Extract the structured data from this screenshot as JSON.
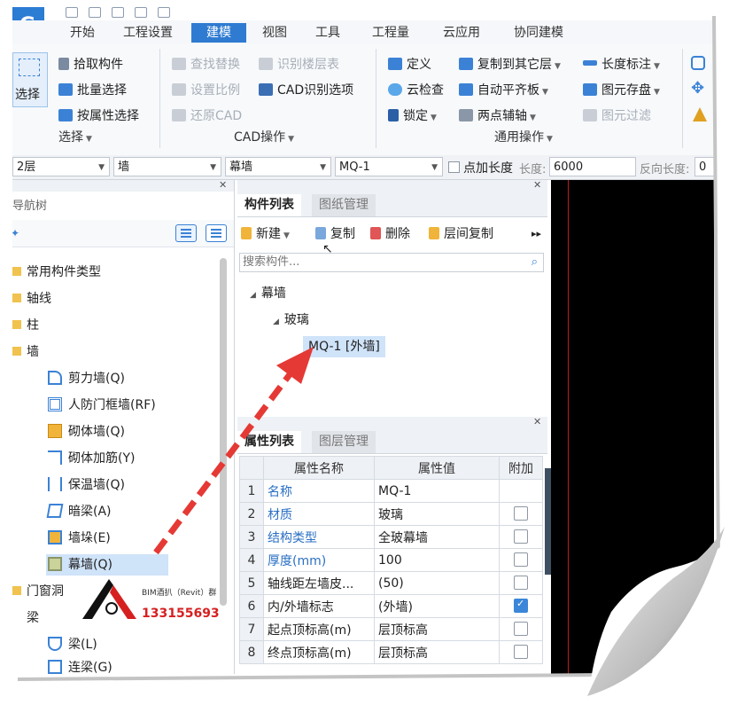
{
  "tabs": [
    "开始",
    "工程设置",
    "建模",
    "视图",
    "工具",
    "工程量",
    "云应用",
    "协同建模"
  ],
  "active_tab": "建模",
  "ribbon": {
    "select_big": "选择",
    "select_items": [
      "拾取构件",
      "批量选择",
      "按属性选择"
    ],
    "select_group": "选择",
    "cad_items": [
      "查找替换",
      "识别楼层表",
      "设置比例",
      "CAD识别选项",
      "还原CAD"
    ],
    "cad_group": "CAD操作",
    "common_col1": [
      "定义",
      "云检查",
      "锁定"
    ],
    "common_col2": [
      "复制到其它层",
      "自动平齐板",
      "两点辅轴"
    ],
    "common_col3": [
      "长度标注",
      "图元存盘",
      "图元过滤"
    ],
    "common_group": "通用操作"
  },
  "selector": {
    "floor": "2层",
    "type": "墙",
    "subtype": "幕墙",
    "component": "MQ-1",
    "point_length_label": "点加长度",
    "length_label": "长度:",
    "length_value": "6000",
    "reverse_label": "反向长度:",
    "reverse_value": "0"
  },
  "nav": {
    "title": "导航树",
    "items": {
      "common": "常用构件类型",
      "axis": "轴线",
      "column": "柱",
      "wall": "墙",
      "shear": "剪力墙(Q)",
      "civil": "人防门框墙(RF)",
      "masonry": "砌体墙(Q)",
      "rebar": "砌体加筋(Y)",
      "insul": "保温墙(Q)",
      "hidden": "暗梁(A)",
      "pier": "墙垛(E)",
      "curtain": "幕墙(Q)",
      "door": "门窗洞",
      "beam": "梁",
      "beam_l": "梁(L)",
      "link": "连梁(G)"
    }
  },
  "component_panel": {
    "tab_list": "构件列表",
    "tab_drawing": "图纸管理",
    "tools": [
      "新建",
      "复制",
      "删除",
      "层间复制"
    ],
    "search_placeholder": "搜索构件...",
    "tree": {
      "root": "幕墙",
      "child": "玻璃",
      "leaf": "MQ-1 [外墙]"
    }
  },
  "property_panel": {
    "tab_props": "属性列表",
    "tab_layers": "图层管理",
    "headers": [
      "属性名称",
      "属性值",
      "附加"
    ],
    "rows": [
      {
        "n": "1",
        "name": "名称",
        "value": "MQ-1",
        "blue": true,
        "check": "none"
      },
      {
        "n": "2",
        "name": "材质",
        "value": "玻璃",
        "blue": true,
        "check": "off"
      },
      {
        "n": "3",
        "name": "结构类型",
        "value": "全玻幕墙",
        "blue": true,
        "check": "off"
      },
      {
        "n": "4",
        "name": "厚度(mm)",
        "value": "100",
        "blue": true,
        "check": "off"
      },
      {
        "n": "5",
        "name": "轴线距左墙皮...",
        "value": "(50)",
        "blue": false,
        "check": "off"
      },
      {
        "n": "6",
        "name": "内/外墙标志",
        "value": "(外墙)",
        "blue": false,
        "check": "on"
      },
      {
        "n": "7",
        "name": "起点顶标高(m)",
        "value": "层顶标高",
        "blue": false,
        "check": "off"
      },
      {
        "n": "8",
        "name": "终点顶标高(m)",
        "value": "层顶标高",
        "blue": false,
        "check": "off"
      }
    ]
  },
  "watermark": {
    "line1": "BIM酒扒（Revit）群",
    "line2": "133155693"
  },
  "colors": {
    "accent": "#2f7bd1",
    "arrow": "#e53935",
    "canvas": "#000000",
    "selection": "#cfe3f9"
  }
}
